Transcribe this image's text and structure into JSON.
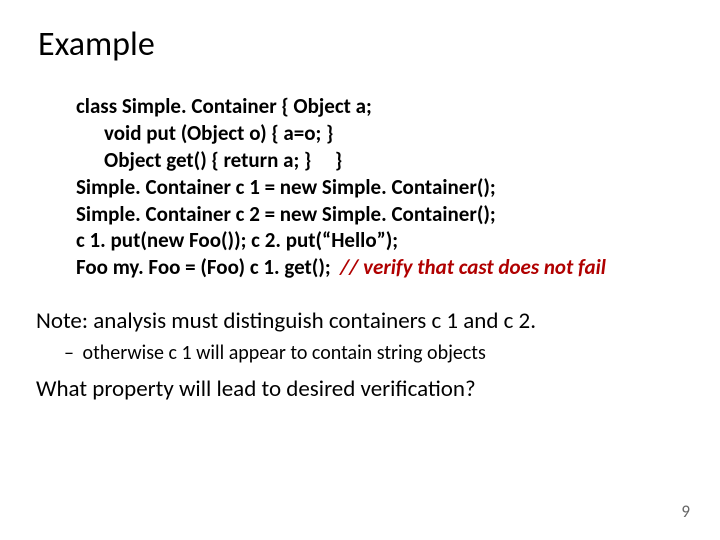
{
  "title": "Example",
  "code": {
    "l1": "class Simple. Container { Object a;",
    "l2": "void put (Object o) { a=o; }",
    "l3": "Object get() { return a; }     }",
    "l4": "Simple. Container c 1 = new Simple. Container();",
    "l5": "Simple. Container c 2 = new Simple. Container();",
    "l6": "c 1. put(new Foo()); c 2. put(“Hello”);",
    "l7a": "Foo my. Foo = (Foo) c 1. get();  ",
    "l7b": "// verify that cast does not fail"
  },
  "note": "Note: analysis must distinguish containers c 1 and c 2.",
  "subnote": "otherwise c 1 will appear to contain string objects",
  "question": "What property will lead to desired verification?",
  "pagenum": "9"
}
